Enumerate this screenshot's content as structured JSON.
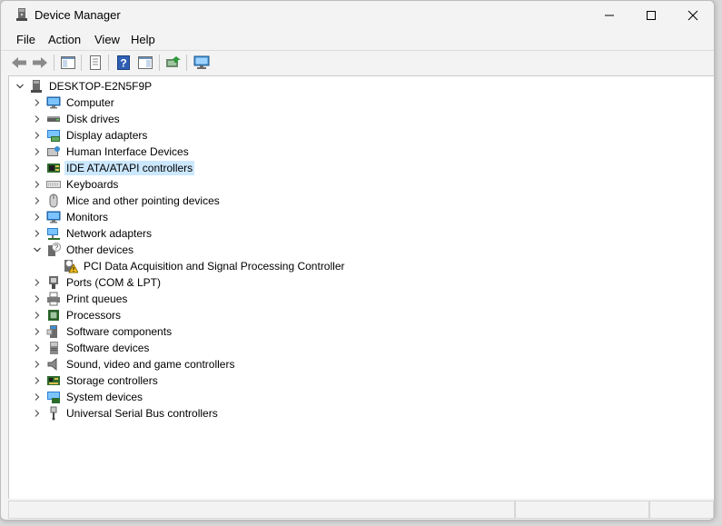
{
  "window": {
    "title": "Device Manager",
    "controls": [
      "minimize",
      "maximize",
      "close"
    ]
  },
  "menu": [
    {
      "label": "File"
    },
    {
      "label": "Action"
    },
    {
      "label": "View"
    },
    {
      "label": "Help"
    }
  ],
  "toolbar": [
    {
      "name": "back-button",
      "icon": "arrow-left-icon"
    },
    {
      "name": "forward-button",
      "icon": "arrow-right-icon"
    },
    {
      "name": "show-hide-console-tree-button",
      "icon": "console-tree-icon"
    },
    {
      "name": "properties-button",
      "icon": "properties-icon"
    },
    {
      "name": "help-button",
      "icon": "help-icon"
    },
    {
      "name": "action-pane-button",
      "icon": "action-pane-icon"
    },
    {
      "name": "update-driver-button",
      "icon": "update-driver-icon"
    },
    {
      "name": "scan-hardware-button",
      "icon": "monitor-scan-icon"
    }
  ],
  "tree": {
    "root": {
      "label": "DESKTOP-E2N5F9P",
      "icon": "computer-tower-icon",
      "expanded": true
    },
    "items": [
      {
        "label": "Computer",
        "icon": "monitor-icon",
        "expanded": false
      },
      {
        "label": "Disk drives",
        "icon": "disk-drive-icon",
        "expanded": false
      },
      {
        "label": "Display adapters",
        "icon": "display-adapter-icon",
        "expanded": false
      },
      {
        "label": "Human Interface Devices",
        "icon": "hid-icon",
        "expanded": false
      },
      {
        "label": "IDE ATA/ATAPI controllers",
        "icon": "ide-controller-icon",
        "expanded": false,
        "selected": true
      },
      {
        "label": "Keyboards",
        "icon": "keyboard-icon",
        "expanded": false
      },
      {
        "label": "Mice and other pointing devices",
        "icon": "mouse-icon",
        "expanded": false
      },
      {
        "label": "Monitors",
        "icon": "monitor-icon",
        "expanded": false
      },
      {
        "label": "Network adapters",
        "icon": "network-adapter-icon",
        "expanded": false
      },
      {
        "label": "Other devices",
        "icon": "unknown-device-icon",
        "expanded": true,
        "children": [
          {
            "label": "PCI Data Acquisition and Signal Processing Controller",
            "icon": "warning-device-icon"
          }
        ]
      },
      {
        "label": "Ports (COM & LPT)",
        "icon": "port-icon",
        "expanded": false
      },
      {
        "label": "Print queues",
        "icon": "printer-icon",
        "expanded": false
      },
      {
        "label": "Processors",
        "icon": "processor-icon",
        "expanded": false
      },
      {
        "label": "Software components",
        "icon": "software-component-icon",
        "expanded": false
      },
      {
        "label": "Software devices",
        "icon": "software-device-icon",
        "expanded": false
      },
      {
        "label": "Sound, video and game controllers",
        "icon": "speaker-icon",
        "expanded": false
      },
      {
        "label": "Storage controllers",
        "icon": "storage-controller-icon",
        "expanded": false
      },
      {
        "label": "System devices",
        "icon": "system-device-icon",
        "expanded": false
      },
      {
        "label": "Universal Serial Bus controllers",
        "icon": "usb-icon",
        "expanded": false
      }
    ]
  },
  "colors": {
    "selection": "#cce8ff",
    "window_bg": "#f3f3f3",
    "tree_bg": "#ffffff"
  }
}
